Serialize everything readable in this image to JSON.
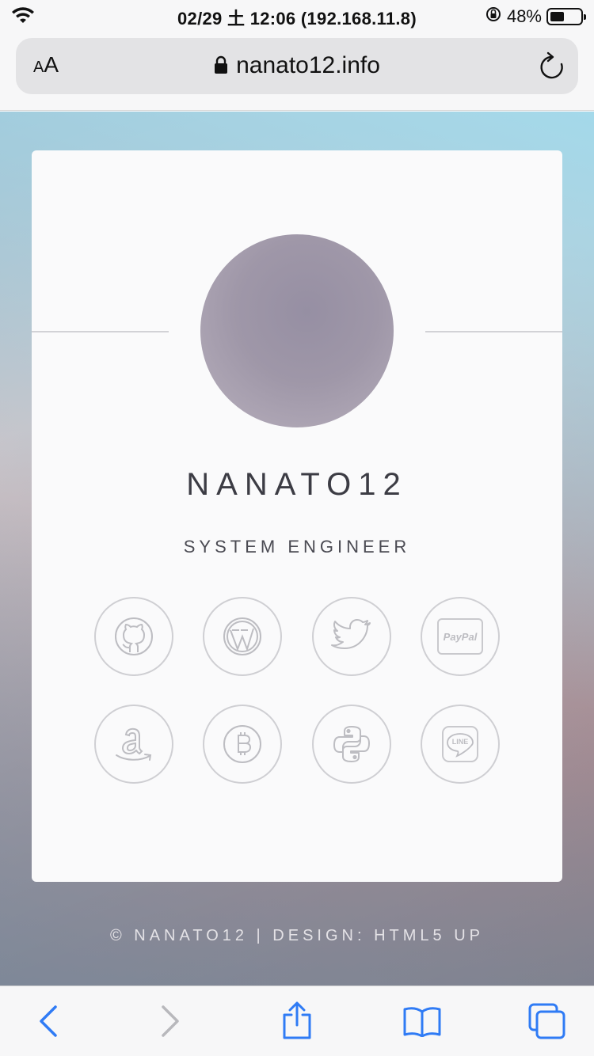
{
  "status_bar": {
    "datetime": "02/29 土 12:06 (192.168.11.8)",
    "battery": "48%",
    "battery_level": 0.48
  },
  "browser": {
    "text_size_label_small": "A",
    "text_size_label_large": "A",
    "url": "nanato12.info"
  },
  "profile": {
    "name": "NANATO12",
    "role": "SYSTEM ENGINEER"
  },
  "social_links": [
    {
      "icon": "github-icon"
    },
    {
      "icon": "wordpress-icon"
    },
    {
      "icon": "twitter-icon"
    },
    {
      "icon": "paypal-icon",
      "label": "PayPal"
    },
    {
      "icon": "amazon-icon"
    },
    {
      "icon": "bitcoin-icon"
    },
    {
      "icon": "python-icon"
    },
    {
      "icon": "line-icon",
      "label": "LINE"
    }
  ],
  "footer": {
    "text": "© NANATO12 | DESIGN: HTML5 UP"
  },
  "toolbar": {
    "items": [
      "back-icon",
      "forward-icon",
      "share-icon",
      "bookmarks-icon",
      "tabs-icon"
    ],
    "accent": "#2f7bf5",
    "disabled": "#b8b8bc"
  }
}
